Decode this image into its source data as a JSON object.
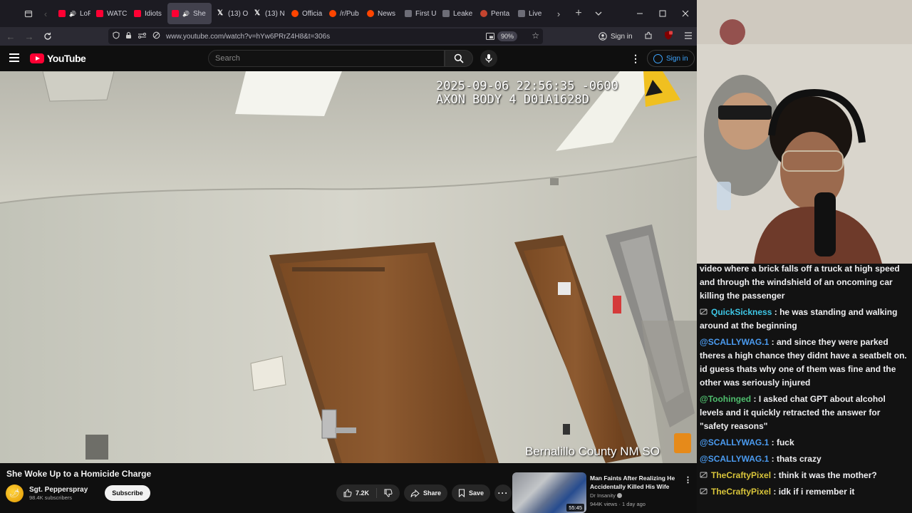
{
  "browser": {
    "tabs": [
      {
        "label": "LoFi D",
        "favicon": "youtube-favicon",
        "audio": true
      },
      {
        "label": "WATC",
        "favicon": "youtube-favicon"
      },
      {
        "label": "Idiots",
        "favicon": "youtube-favicon"
      },
      {
        "label": "She",
        "favicon": "youtube-favicon",
        "active": true,
        "audio": true
      },
      {
        "label": "(13) O",
        "favicon": "x-favicon"
      },
      {
        "label": "(13) N",
        "favicon": "x-favicon"
      },
      {
        "label": "Officia",
        "favicon": "reddit-favicon"
      },
      {
        "label": "/r/Pub",
        "favicon": "reddit-favicon"
      },
      {
        "label": "News",
        "favicon": "reddit-favicon"
      },
      {
        "label": "First U",
        "favicon": "page-favicon"
      },
      {
        "label": "Leake",
        "favicon": "page-favicon"
      },
      {
        "label": "Penta",
        "favicon": "pentagon-favicon"
      },
      {
        "label": "Live",
        "favicon": "page-favicon"
      }
    ],
    "url": "www.youtube.com/watch?v=hYw6PRrZ4H8&t=306s",
    "zoom": "90%",
    "sign_in": "Sign in"
  },
  "youtube": {
    "logo_text": "YouTube",
    "search_placeholder": "Search",
    "sign_in": "Sign in"
  },
  "video": {
    "timestamp_line1": "2025-09-06 22:56:35 -0600",
    "timestamp_line2": "AXON BODY 4 D01A1628D",
    "agency_overlay": "Bernalillo County NM SO",
    "title": "She Woke Up to a Homicide Charge",
    "channel": "Sgt. Pepperspray",
    "subscribers": "98.4K subscribers",
    "subscribe_label": "Subscribe",
    "likes": "7.2K",
    "share_label": "Share",
    "save_label": "Save"
  },
  "recommended": {
    "title": "Man Faints After Realizing He Accidentally Killed His Wife",
    "channel": "Dr Insanity",
    "views": "944K views",
    "age": "1 day ago",
    "duration": "55:45"
  },
  "chat": [
    {
      "user": "",
      "text": "video where a brick falls off a truck at high speed and through the windshield of an oncoming car killing the passenger",
      "color": "#efeff1",
      "badge": false
    },
    {
      "user": "QuickSickness",
      "text": "he was standing and walking around at the beginning",
      "color": "#3ec7e6",
      "badge": true
    },
    {
      "user": "@SCALLYWAG.1",
      "text": "and since they were parked theres a high chance they didnt have a seatbelt on. id guess thats why one of them was fine and the other was seriously injured",
      "color": "#4b9bf0",
      "badge": false
    },
    {
      "user": "@Toohinged",
      "text": "I asked chat GPT about alcohol levels and it quickly retracted the answer for \"safety reasons\"",
      "color": "#4fbf6e",
      "badge": false
    },
    {
      "user": "@SCALLYWAG.1",
      "text": "fuck",
      "color": "#4b9bf0",
      "badge": false
    },
    {
      "user": "@SCALLYWAG.1",
      "text": "thats crazy",
      "color": "#4b9bf0",
      "badge": false
    },
    {
      "user": "TheCraftyPixel",
      "text": "think it was the mother?",
      "color": "#d8c43a",
      "badge": true
    },
    {
      "user": "TheCraftyPixel",
      "text": "idk if i remember it",
      "color": "#d8c43a",
      "badge": true
    }
  ]
}
